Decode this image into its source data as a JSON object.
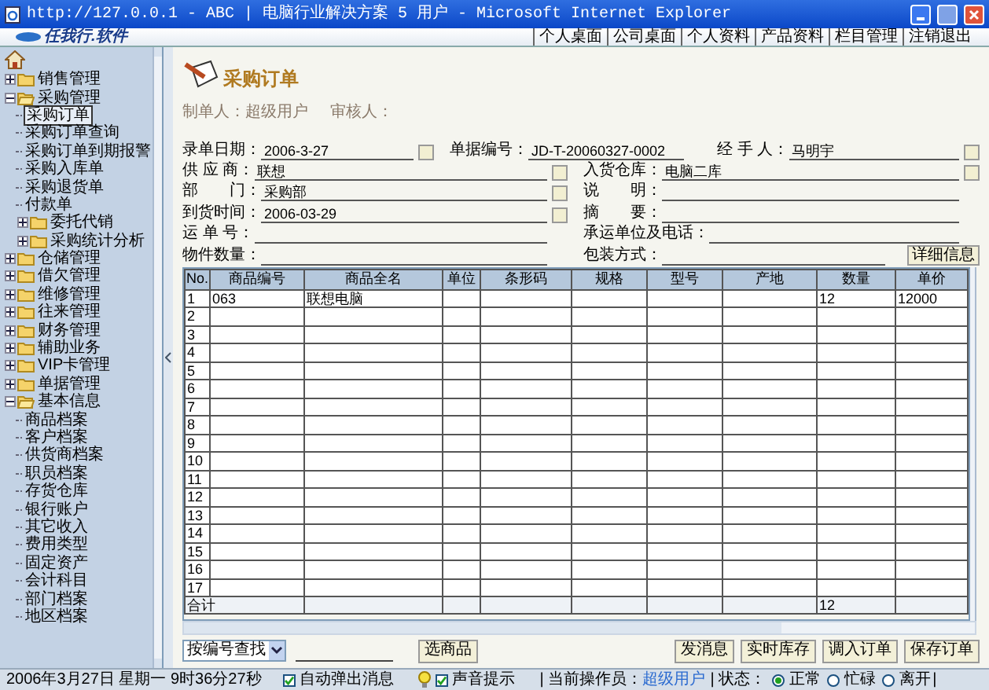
{
  "window": {
    "title": "http://127.0.0.1 - ABC  | 电脑行业解决方案 5 用户 - Microsoft Internet Explorer"
  },
  "top_bar": {
    "logo": "任我行.软件",
    "links": [
      "个人桌面",
      "公司桌面",
      "个人资料",
      "产品资料",
      "栏目管理",
      "注销退出"
    ]
  },
  "sidebar": {
    "items": [
      {
        "label": "销售管理",
        "kind": "folder",
        "expanded": false,
        "selected": false
      },
      {
        "label": "采购管理",
        "kind": "folder",
        "expanded": true,
        "selected": false,
        "children": [
          {
            "label": "采购订单",
            "kind": "leaf",
            "selected": true
          },
          {
            "label": "采购订单查询",
            "kind": "leaf",
            "selected": false
          },
          {
            "label": "采购订单到期报警",
            "kind": "leaf",
            "selected": false
          },
          {
            "label": "采购入库单",
            "kind": "leaf",
            "selected": false
          },
          {
            "label": "采购退货单",
            "kind": "leaf",
            "selected": false
          },
          {
            "label": "付款单",
            "kind": "leaf",
            "selected": false
          },
          {
            "label": "委托代销",
            "kind": "folder",
            "expanded": false,
            "selected": false
          },
          {
            "label": "采购统计分析",
            "kind": "folder",
            "expanded": false,
            "selected": false
          }
        ]
      },
      {
        "label": "仓储管理",
        "kind": "folder",
        "expanded": false,
        "selected": false
      },
      {
        "label": "借欠管理",
        "kind": "folder",
        "expanded": false,
        "selected": false
      },
      {
        "label": "维修管理",
        "kind": "folder",
        "expanded": false,
        "selected": false
      },
      {
        "label": "往来管理",
        "kind": "folder",
        "expanded": false,
        "selected": false
      },
      {
        "label": "财务管理",
        "kind": "folder",
        "expanded": false,
        "selected": false
      },
      {
        "label": "辅助业务",
        "kind": "folder",
        "expanded": false,
        "selected": false
      },
      {
        "label": "VIP卡管理",
        "kind": "folder",
        "expanded": false,
        "selected": false
      },
      {
        "label": "单据管理",
        "kind": "folder",
        "expanded": false,
        "selected": false
      },
      {
        "label": "基本信息",
        "kind": "folder",
        "expanded": true,
        "selected": false,
        "children": [
          {
            "label": "商品档案",
            "kind": "leaf",
            "selected": false
          },
          {
            "label": "客户档案",
            "kind": "leaf",
            "selected": false
          },
          {
            "label": "供货商档案",
            "kind": "leaf",
            "selected": false
          },
          {
            "label": "职员档案",
            "kind": "leaf",
            "selected": false
          },
          {
            "label": "存货仓库",
            "kind": "leaf",
            "selected": false
          },
          {
            "label": "银行账户",
            "kind": "leaf",
            "selected": false
          },
          {
            "label": "其它收入",
            "kind": "leaf",
            "selected": false
          },
          {
            "label": "费用类型",
            "kind": "leaf",
            "selected": false
          },
          {
            "label": "固定资产",
            "kind": "leaf",
            "selected": false
          },
          {
            "label": "会计科目",
            "kind": "leaf",
            "selected": false
          },
          {
            "label": "部门档案",
            "kind": "leaf",
            "selected": false
          },
          {
            "label": "地区档案",
            "kind": "leaf",
            "selected": false
          }
        ]
      }
    ]
  },
  "page": {
    "title": "采购订单",
    "meta": [
      "制单人：超级用户",
      "审核人："
    ]
  },
  "form": {
    "rows": [
      [
        {
          "label": "录单日期：",
          "value": "2006-3-27",
          "picker": true
        },
        {
          "label": "单据编号：",
          "value": "JD-T-20060327-0002",
          "picker": false
        },
        {
          "label": "经 手 人：",
          "value": "马明宇",
          "picker": true
        }
      ],
      [
        {
          "label": "供 应 商：",
          "value": "联想",
          "picker": true
        },
        {
          "label": "入货仓库：",
          "value": "电脑二库",
          "picker": true
        }
      ],
      [
        {
          "label": "部　　门：",
          "value": "采购部",
          "picker": true
        },
        {
          "label": "说　　明：",
          "picker": false
        }
      ],
      [
        {
          "label": "到货时间：",
          "value": "2006-03-29",
          "picker": true
        },
        {
          "label": "摘　　要：",
          "picker": false
        }
      ],
      [
        {
          "label": "运 单 号：",
          "picker": false
        },
        {
          "label": "承运单位及电话：",
          "picker": false
        }
      ],
      [
        {
          "label": "物件数量：",
          "picker": false
        },
        {
          "label": "包装方式：",
          "picker": false
        }
      ]
    ],
    "detail_button": "详细信息"
  },
  "table": {
    "columns": [
      "No.",
      "商品编号",
      "商品全名",
      "单位",
      "条形码",
      "规格",
      "型号",
      "产地",
      "数量",
      "单价"
    ],
    "rows": [
      [
        "1",
        "063",
        "联想电脑",
        "",
        "",
        "",
        "",
        "",
        "12",
        "12000"
      ],
      [
        "2"
      ],
      [
        "3"
      ],
      [
        "4"
      ],
      [
        "5"
      ],
      [
        "6"
      ],
      [
        "7"
      ],
      [
        "8"
      ],
      [
        "9"
      ],
      [
        "10"
      ],
      [
        "11"
      ],
      [
        "12"
      ],
      [
        "13"
      ],
      [
        "14"
      ],
      [
        "15"
      ],
      [
        "16"
      ],
      [
        "17"
      ]
    ],
    "total_row": {
      "label": "合计",
      "quantity": "12"
    }
  },
  "bottom": {
    "search_mode": "按编号查找",
    "pick_button": "选商品",
    "actions": [
      "发消息",
      "实时库存",
      "调入订单",
      "保存订单"
    ]
  },
  "status_bar": {
    "datetime": "2006年3月27日 星期一 9时36分27秒",
    "checks": [
      {
        "label": "自动弹出消息",
        "checked": true
      },
      {
        "label": "声音提示",
        "checked": true
      }
    ],
    "operator_label": "| 当前操作员：",
    "operator": "超级用户",
    "state_label": "| 状态：",
    "states": [
      {
        "label": "正常",
        "selected": true
      },
      {
        "label": "忙碌",
        "selected": false
      },
      {
        "label": "离开",
        "selected": false
      }
    ],
    "end_mark": "|"
  }
}
